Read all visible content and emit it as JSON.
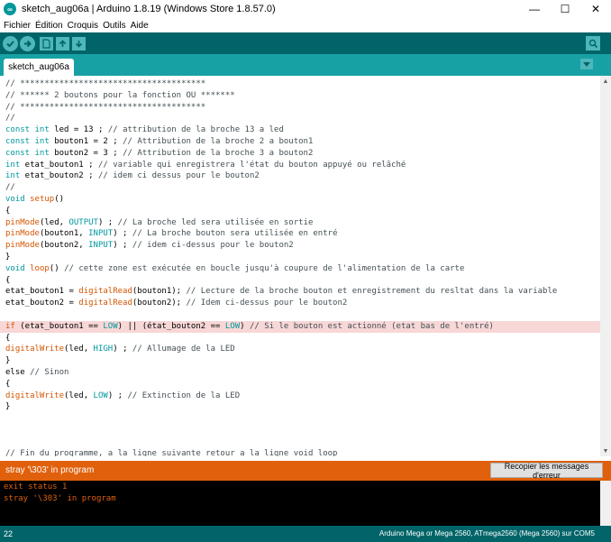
{
  "window": {
    "title": "sketch_aug06a | Arduino 1.8.19 (Windows Store 1.8.57.0)",
    "minimize": "—",
    "maximize": "☐",
    "close": "✕"
  },
  "menu": {
    "items": [
      "Fichier",
      "Édition",
      "Croquis",
      "Outils",
      "Aide"
    ]
  },
  "tabs": {
    "active": "sketch_aug06a"
  },
  "editor": {
    "lines": [
      {
        "n": 0,
        "parts": [
          {
            "t": "// **************************************",
            "c": "comment"
          }
        ]
      },
      {
        "n": 1,
        "parts": [
          {
            "t": "// ****** 2 boutons pour la fonction OU *******",
            "c": "comment"
          }
        ]
      },
      {
        "n": 2,
        "parts": [
          {
            "t": "// **************************************",
            "c": "comment"
          }
        ]
      },
      {
        "n": 3,
        "parts": [
          {
            "t": "//",
            "c": "comment"
          }
        ]
      },
      {
        "n": 4,
        "parts": [
          {
            "t": "const",
            "c": "type"
          },
          {
            "t": " ",
            "c": ""
          },
          {
            "t": "int",
            "c": "type"
          },
          {
            "t": " led = 13 ; ",
            "c": ""
          },
          {
            "t": "// attribution de la broche 13 a led",
            "c": "comment"
          }
        ]
      },
      {
        "n": 5,
        "parts": [
          {
            "t": "const",
            "c": "type"
          },
          {
            "t": " ",
            "c": ""
          },
          {
            "t": "int",
            "c": "type"
          },
          {
            "t": " bouton1 = 2 ; ",
            "c": ""
          },
          {
            "t": "// Attribution de la broche 2 a bouton1",
            "c": "comment"
          }
        ]
      },
      {
        "n": 6,
        "parts": [
          {
            "t": "const",
            "c": "type"
          },
          {
            "t": " ",
            "c": ""
          },
          {
            "t": "int",
            "c": "type"
          },
          {
            "t": " bouton2 = 3 ; ",
            "c": ""
          },
          {
            "t": "// Attribution de la broche 3 a bouton2",
            "c": "comment"
          }
        ]
      },
      {
        "n": 7,
        "parts": [
          {
            "t": "int",
            "c": "type"
          },
          {
            "t": " etat_bouton1 ; ",
            "c": ""
          },
          {
            "t": "// variable qui enregistrera l'état du bouton appuyé ou relâché",
            "c": "comment"
          }
        ]
      },
      {
        "n": 8,
        "parts": [
          {
            "t": "int",
            "c": "type"
          },
          {
            "t": " etat_bouton2 ; ",
            "c": ""
          },
          {
            "t": "// idem ci dessus pour le bouton2",
            "c": "comment"
          }
        ]
      },
      {
        "n": 9,
        "parts": [
          {
            "t": "//",
            "c": "comment"
          }
        ]
      },
      {
        "n": 10,
        "parts": [
          {
            "t": "void",
            "c": "type"
          },
          {
            "t": " ",
            "c": ""
          },
          {
            "t": "setup",
            "c": "fn"
          },
          {
            "t": "()",
            "c": ""
          }
        ]
      },
      {
        "n": 11,
        "parts": [
          {
            "t": "{",
            "c": ""
          }
        ]
      },
      {
        "n": 12,
        "parts": [
          {
            "t": "pinMode",
            "c": "fn"
          },
          {
            "t": "(led, ",
            "c": ""
          },
          {
            "t": "OUTPUT",
            "c": "const"
          },
          {
            "t": ") ; ",
            "c": ""
          },
          {
            "t": "// La broche led sera utilisée en sortie",
            "c": "comment"
          }
        ]
      },
      {
        "n": 13,
        "parts": [
          {
            "t": "pinMode",
            "c": "fn"
          },
          {
            "t": "(bouton1, ",
            "c": ""
          },
          {
            "t": "INPUT",
            "c": "const"
          },
          {
            "t": ") ; ",
            "c": ""
          },
          {
            "t": "// La broche bouton sera utilisée en entré",
            "c": "comment"
          }
        ]
      },
      {
        "n": 14,
        "parts": [
          {
            "t": "pinMode",
            "c": "fn"
          },
          {
            "t": "(bouton2, ",
            "c": ""
          },
          {
            "t": "INPUT",
            "c": "const"
          },
          {
            "t": ") ; ",
            "c": ""
          },
          {
            "t": "// idem ci-dessus pour le bouton2",
            "c": "comment"
          }
        ]
      },
      {
        "n": 15,
        "parts": [
          {
            "t": "}",
            "c": ""
          }
        ]
      },
      {
        "n": 16,
        "parts": [
          {
            "t": "void",
            "c": "type"
          },
          {
            "t": " ",
            "c": ""
          },
          {
            "t": "loop",
            "c": "fn"
          },
          {
            "t": "() ",
            "c": ""
          },
          {
            "t": "// cette zone est exécutée en boucle jusqu'à coupure de l'alimentation de la carte",
            "c": "comment"
          }
        ]
      },
      {
        "n": 17,
        "parts": [
          {
            "t": "{",
            "c": ""
          }
        ]
      },
      {
        "n": 18,
        "parts": [
          {
            "t": "etat_bouton1 = ",
            "c": ""
          },
          {
            "t": "digitalRead",
            "c": "fn"
          },
          {
            "t": "(bouton1); ",
            "c": ""
          },
          {
            "t": "// Lecture de la broche bouton et enregistrement du resltat dans la variable",
            "c": "comment"
          }
        ]
      },
      {
        "n": 19,
        "parts": [
          {
            "t": "etat_bouton2 = ",
            "c": ""
          },
          {
            "t": "digitalRead",
            "c": "fn"
          },
          {
            "t": "(bouton2); ",
            "c": ""
          },
          {
            "t": "// Idem ci-dessus pour le bouton2",
            "c": "comment"
          }
        ]
      },
      {
        "n": 20,
        "parts": [
          {
            "t": "",
            "c": ""
          }
        ]
      },
      {
        "n": 21,
        "parts": [
          {
            "t": "if",
            "c": "fn"
          },
          {
            "t": " (etat_bouton1 == ",
            "c": ""
          },
          {
            "t": "LOW",
            "c": "const"
          },
          {
            "t": ") || (état_bouton2 == ",
            "c": ""
          },
          {
            "t": "LOW",
            "c": "const"
          },
          {
            "t": ") ",
            "c": ""
          },
          {
            "t": "// Si le bouton est actionné (etat bas de l'entré)",
            "c": "comment"
          }
        ]
      },
      {
        "n": 22,
        "parts": [
          {
            "t": "{",
            "c": ""
          }
        ]
      },
      {
        "n": 23,
        "parts": [
          {
            "t": "digitalWrite",
            "c": "fn"
          },
          {
            "t": "(led, ",
            "c": ""
          },
          {
            "t": "HIGH",
            "c": "const"
          },
          {
            "t": ") ; ",
            "c": ""
          },
          {
            "t": "// Allumage de la LED",
            "c": "comment"
          }
        ]
      },
      {
        "n": 24,
        "parts": [
          {
            "t": "}",
            "c": ""
          }
        ]
      },
      {
        "n": 25,
        "parts": [
          {
            "t": "else ",
            "c": ""
          },
          {
            "t": "// Sinon",
            "c": "comment"
          }
        ]
      },
      {
        "n": 26,
        "parts": [
          {
            "t": "{",
            "c": ""
          }
        ]
      },
      {
        "n": 27,
        "parts": [
          {
            "t": "digitalWrite",
            "c": "fn"
          },
          {
            "t": "(led, ",
            "c": ""
          },
          {
            "t": "LOW",
            "c": "const"
          },
          {
            "t": ") ; ",
            "c": ""
          },
          {
            "t": "// Extinction de la LED",
            "c": "comment"
          }
        ]
      },
      {
        "n": 28,
        "parts": [
          {
            "t": "}",
            "c": ""
          }
        ]
      },
      {
        "n": 29,
        "parts": [
          {
            "t": "",
            "c": ""
          }
        ]
      },
      {
        "n": 30,
        "parts": [
          {
            "t": "",
            "c": ""
          }
        ]
      },
      {
        "n": 31,
        "parts": [
          {
            "t": "",
            "c": ""
          }
        ]
      },
      {
        "n": 32,
        "parts": [
          {
            "t": "// Fin du programme, a la ligne suivante retour a la ligne void loop",
            "c": "comment"
          }
        ]
      }
    ],
    "highlighted_line": 21
  },
  "status": {
    "message": "stray '\\303' in program",
    "copy_button": "Recopier les messages d'erreur"
  },
  "console": {
    "lines": [
      "exit status 1",
      "stray '\\303' in program"
    ]
  },
  "footer": {
    "line_number": "22",
    "board": "Arduino Mega or Mega 2560, ATmega2560 (Mega 2560) sur COM5"
  },
  "colors": {
    "teal_dark": "#006468",
    "teal_tab": "#17a1a5",
    "error_orange": "#e0600c",
    "highlight_error": "#f8d7d7"
  }
}
